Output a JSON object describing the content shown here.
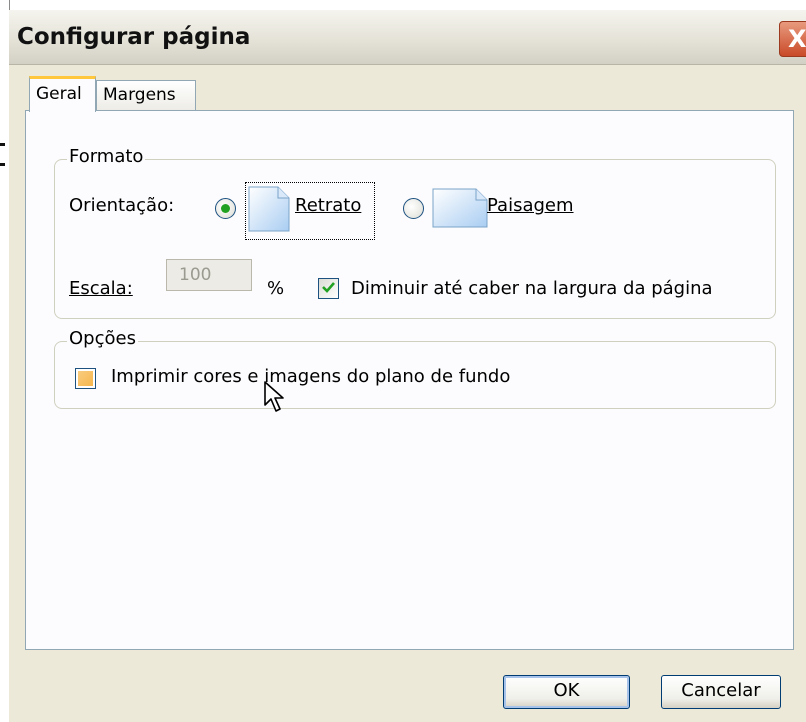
{
  "window": {
    "title": "Configurar página",
    "close_symbol": "X"
  },
  "tabs": [
    {
      "label": "Geral",
      "active": true
    },
    {
      "label": "Margens",
      "active": false
    }
  ],
  "formato": {
    "legend": "Formato",
    "orientation_label": "Orientação:",
    "options": [
      {
        "label": "Retrato",
        "selected": true,
        "icon": "portrait-page-icon"
      },
      {
        "label": "Paisagem",
        "selected": false,
        "icon": "landscape-page-icon"
      }
    ],
    "scale_label": "Escala:",
    "scale_value": "100",
    "percent_symbol": "%",
    "shrink_label": "Diminuir até caber na largura da página",
    "shrink_checked": true
  },
  "opcoes": {
    "legend": "Opções",
    "print_bg_label": "Imprimir cores e imagens do plano de fundo",
    "print_bg_checked": false
  },
  "buttons": {
    "ok": "OK",
    "cancel": "Cancelar"
  },
  "colors": {
    "dialog_bg": "#ece9d8",
    "radio_dot": "#21a121",
    "close_button": "#c94a28",
    "tab_highlight": "#ffc83c"
  }
}
